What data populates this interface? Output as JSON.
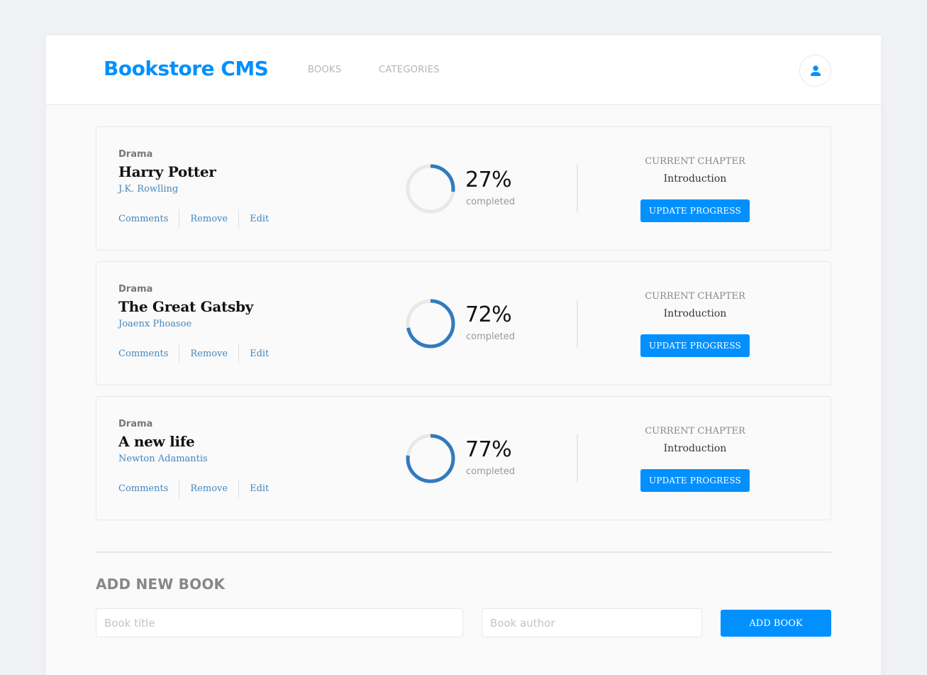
{
  "header": {
    "brand": "Bookstore CMS",
    "nav": [
      "BOOKS",
      "CATEGORIES"
    ],
    "avatar_icon": "user-icon"
  },
  "books": [
    {
      "genre": "Drama",
      "title": "Harry Potter",
      "author": "J.K. Rowlling",
      "actions": [
        "Comments",
        "Remove",
        "Edit"
      ],
      "progress": 27,
      "percent_text": "27%",
      "completed_label": "completed",
      "chapter_label": "CURRENT CHAPTER",
      "chapter": "Introduction",
      "update_label": "UPDATE PROGRESS"
    },
    {
      "genre": "Drama",
      "title": "The Great Gatsby",
      "author": "Joaenx Phoasoe",
      "actions": [
        "Comments",
        "Remove",
        "Edit"
      ],
      "progress": 72,
      "percent_text": "72%",
      "completed_label": "completed",
      "chapter_label": "CURRENT CHAPTER",
      "chapter": "Introduction",
      "update_label": "UPDATE PROGRESS"
    },
    {
      "genre": "Drama",
      "title": "A new life",
      "author": "Newton Adamantis",
      "actions": [
        "Comments",
        "Remove",
        "Edit"
      ],
      "progress": 77,
      "percent_text": "77%",
      "completed_label": "completed",
      "chapter_label": "CURRENT CHAPTER",
      "chapter": "Introduction",
      "update_label": "UPDATE PROGRESS"
    }
  ],
  "form": {
    "title": "ADD NEW BOOK",
    "title_placeholder": "Book title",
    "author_placeholder": "Book author",
    "submit_label": "ADD BOOK"
  },
  "colors": {
    "accent": "#0290ff",
    "progress": "#307bbe",
    "link": "#4386bf"
  }
}
